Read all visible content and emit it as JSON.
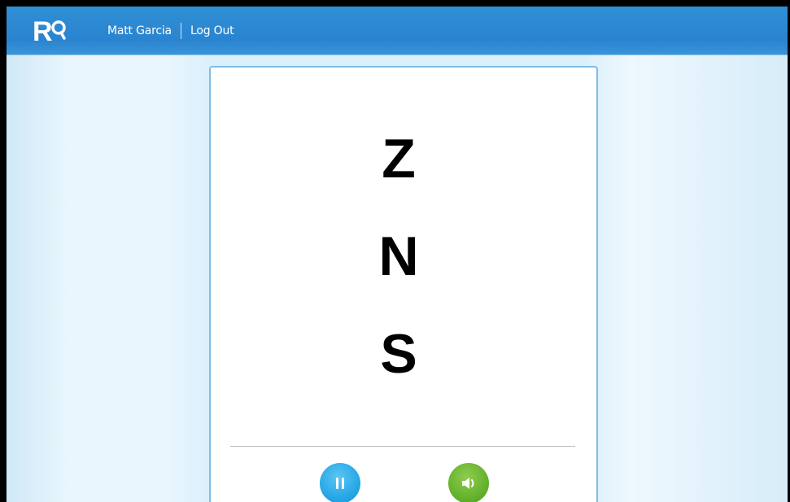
{
  "header": {
    "logo_text": "R",
    "user_name": "Matt Garcia",
    "logout_label": "Log Out"
  },
  "test": {
    "letters": [
      "Z",
      "N",
      "S"
    ]
  },
  "controls": {
    "pause_icon": "pause-icon",
    "sound_icon": "speaker-icon"
  },
  "colors": {
    "header_blue": "#2a84cf",
    "pause_blue": "#27a7e6",
    "sound_green": "#64b22d"
  }
}
